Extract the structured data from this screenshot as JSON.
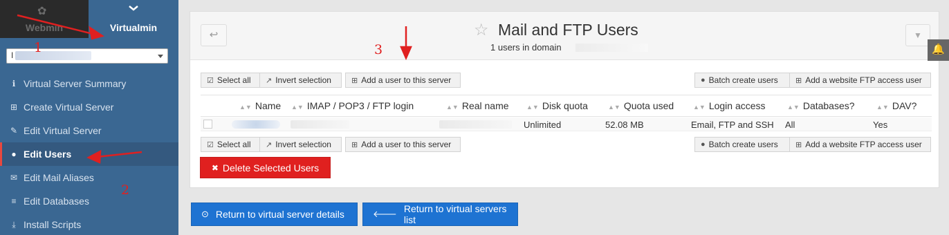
{
  "switcher": {
    "webmin_label": "Webmin",
    "virtualmin_label": "Virtualmin"
  },
  "domain_select": {
    "value": "I"
  },
  "sidebar": {
    "items": [
      {
        "label": "Virtual Server Summary",
        "icon": "info-circle-icon"
      },
      {
        "label": "Create Virtual Server",
        "icon": "plus-square-icon"
      },
      {
        "label": "Edit Virtual Server",
        "icon": "edit-icon"
      },
      {
        "label": "Edit Users",
        "icon": "users-icon",
        "active": true
      },
      {
        "label": "Edit Mail Aliases",
        "icon": "envelope-icon"
      },
      {
        "label": "Edit Databases",
        "icon": "database-icon"
      },
      {
        "label": "Install Scripts",
        "icon": "download-icon"
      }
    ]
  },
  "page": {
    "title": "Mail and FTP Users",
    "subtitle": "1 users in domain"
  },
  "toolbar": {
    "select_all": "Select all",
    "invert_selection": "Invert selection",
    "add_user": "Add a user to this server",
    "batch_create": "Batch create users",
    "add_website_ftp": "Add a website FTP access user"
  },
  "table": {
    "columns": [
      "Name",
      "IMAP / POP3 / FTP login",
      "Real name",
      "Disk quota",
      "Quota used",
      "Login access",
      "Databases?",
      "DAV?"
    ],
    "rows": [
      {
        "disk_quota": "Unlimited",
        "quota_used": "52.08 MB",
        "login_access": "Email, FTP and SSH",
        "databases": "All",
        "dav": "Yes"
      }
    ]
  },
  "actions": {
    "delete_selected": "Delete Selected Users",
    "return_details": "Return to virtual server details",
    "return_list": "Return to virtual servers list"
  },
  "annotations": {
    "one": "1",
    "two": "2",
    "three": "3"
  },
  "colors": {
    "sidebar": "#3a6792",
    "danger": "#e0201f",
    "primary": "#1e73d2",
    "annotation": "#e02020"
  }
}
